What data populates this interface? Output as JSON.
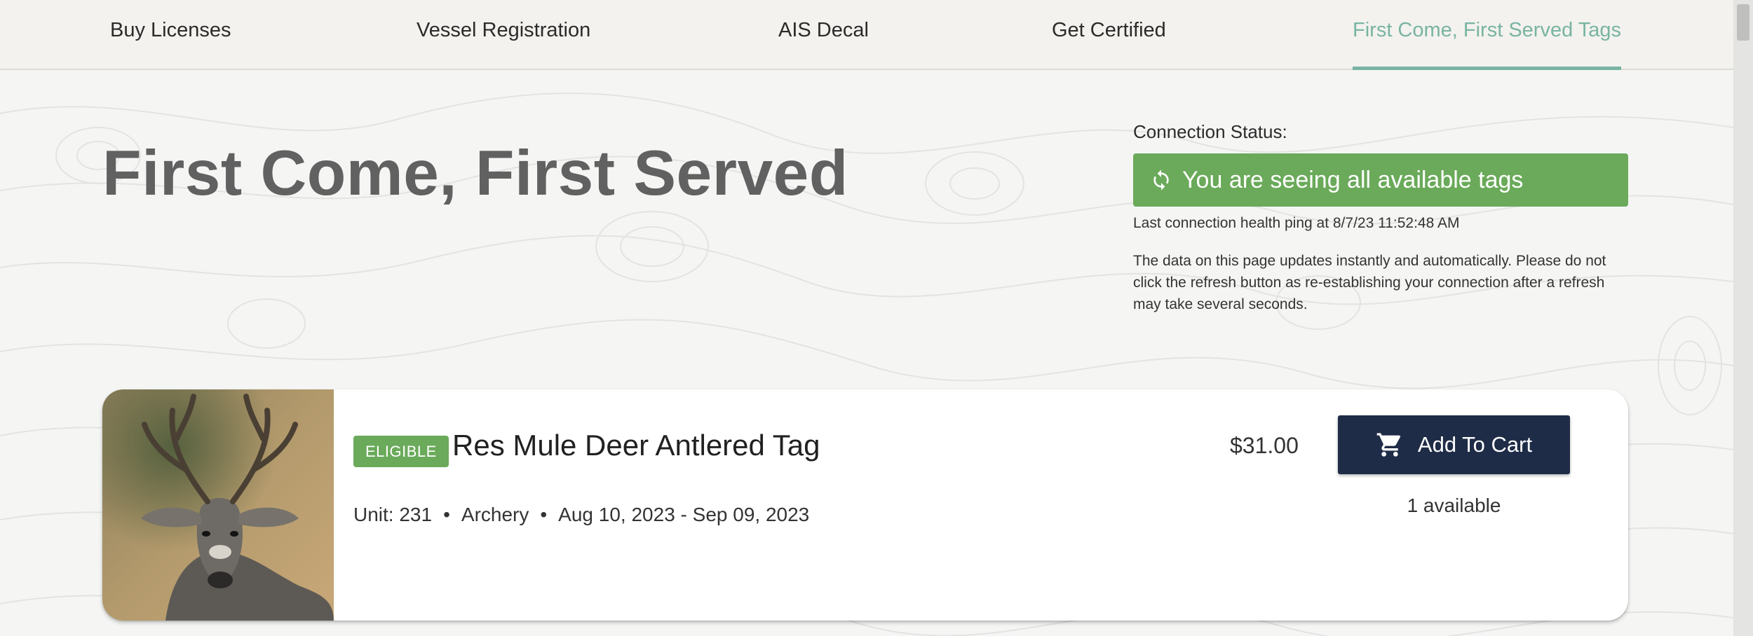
{
  "nav": {
    "items": [
      {
        "label": "Buy Licenses",
        "active": false
      },
      {
        "label": "Vessel Registration",
        "active": false
      },
      {
        "label": "AIS Decal",
        "active": false
      },
      {
        "label": "Get Certified",
        "active": false
      },
      {
        "label": "First Come, First Served Tags",
        "active": true
      }
    ]
  },
  "page": {
    "title": "First Come, First Served"
  },
  "connection": {
    "label": "Connection Status:",
    "status_text": "You are seeing all available tags",
    "status_icon": "sync-icon",
    "last_ping": "Last connection health ping at 8/7/23 11:52:48 AM",
    "note": "The data on this page updates instantly and automatically. Please do not click the refresh button as re-establishing your connection after a refresh may take several seconds."
  },
  "tags": [
    {
      "badge": "ELIGIBLE",
      "name": "Res Mule Deer Antlered Tag",
      "unit": "Unit: 231",
      "weapon": "Archery",
      "dates": "Aug 10, 2023 - Sep 09, 2023",
      "separator": "•",
      "price": "$31.00",
      "button_label": "Add To Cart",
      "button_icon": "cart-icon",
      "availability": "1 available",
      "image": "mule-deer-buck-photo"
    }
  ],
  "colors": {
    "accent_teal": "#79b4a3",
    "status_green": "#6aaa5a",
    "button_navy": "#1f2c47",
    "title_gray": "#616161"
  }
}
